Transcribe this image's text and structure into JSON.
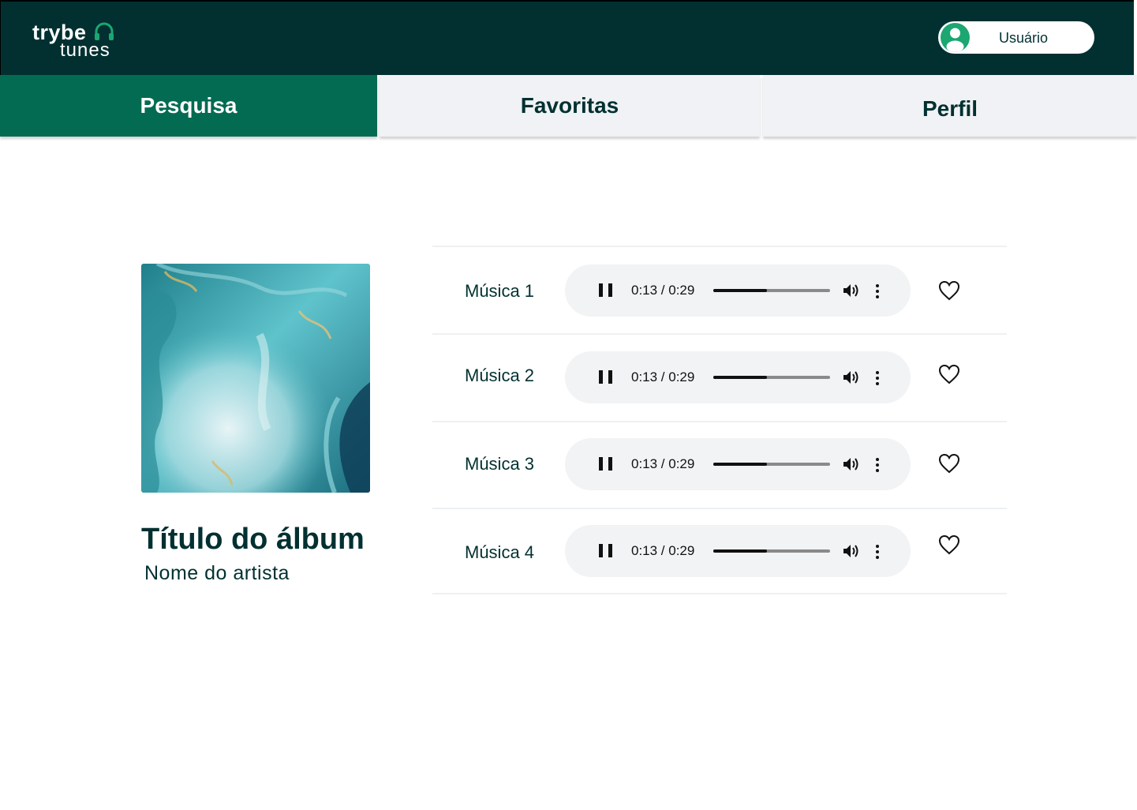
{
  "header": {
    "logo_top": "trybe",
    "logo_bottom": "tunes",
    "user_name": "Usuário"
  },
  "tabs": [
    {
      "label": "Pesquisa",
      "active": true
    },
    {
      "label": "Favoritas",
      "active": false
    },
    {
      "label": "Perfil",
      "active": false
    }
  ],
  "album": {
    "title": "Título do álbum",
    "artist": "Nome do artista"
  },
  "tracks": [
    {
      "name": "Música 1",
      "time": "0:13 / 0:29",
      "progress": 0.46,
      "favorite": false
    },
    {
      "name": "Música 2",
      "time": "0:13 / 0:29",
      "progress": 0.46,
      "favorite": false
    },
    {
      "name": "Música 3",
      "time": "0:13 / 0:29",
      "progress": 0.46,
      "favorite": false
    },
    {
      "name": "Música 4",
      "time": "0:13 / 0:29",
      "progress": 0.46,
      "favorite": false
    }
  ],
  "colors": {
    "header_bg": "#023031",
    "active_tab_bg": "#036b52",
    "tab_bg": "#f0f2f5",
    "accent_green": "#1ba672",
    "player_bg": "#f1f3f4"
  },
  "icons": {
    "logo": "headphones-icon",
    "avatar": "user-avatar-icon",
    "play": "pause-icon",
    "volume": "volume-icon",
    "more": "more-vertical-icon",
    "favorite": "heart-outline-icon"
  }
}
